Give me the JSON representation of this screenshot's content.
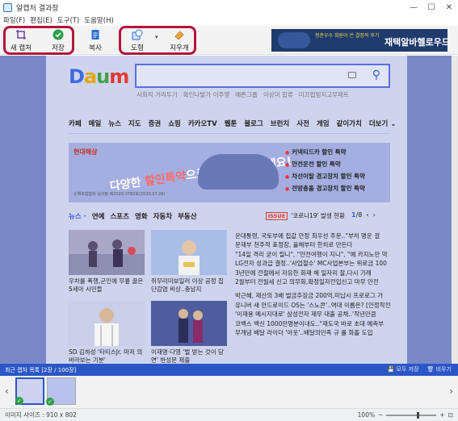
{
  "window": {
    "title": "알캡처 결과창",
    "controls": {
      "minimize": "—",
      "maximize": "☐",
      "close": "✕"
    }
  },
  "menu": [
    "파일(F)",
    "편집(E)",
    "도구(T)",
    "도움말(H)"
  ],
  "toolbar": {
    "new_capture": "새 캡처",
    "save": "저장",
    "copy": "복사",
    "shape": "도형",
    "eraser": "지우개"
  },
  "ad": {
    "small_text": "청춘우수 회원이 쓴 결정적 후기",
    "big_text": "재택알바헬로우드림"
  },
  "daum": {
    "logo": {
      "d": "D",
      "a": "a",
      "u": "u",
      "m": "m"
    },
    "quick_links": [
      "사회적 거리두기",
      "확인나발가 이주영",
      "예른그룹",
      "이상미 합류",
      "미끄럽빙지고무패트"
    ],
    "gnb": [
      "카페",
      "메일",
      "뉴스",
      "지도",
      "증권",
      "쇼핑",
      "카카오TV",
      "웹툰",
      "블로그",
      "브런치",
      "사전",
      "게임",
      "같이가치",
      "더보기 ⌄"
    ],
    "banner": {
      "brand": "현대해상",
      "slogan_prefix": "다양한",
      "slogan_accent": "할인특약",
      "slogan_suffix": "으로 안전 운전하세요!",
      "specials": [
        "커넥티드카 할인 특약",
        "안전운전 할인 특약",
        "차선이탈 경고장치 할인 특약",
        "전방충돌 경고장치 할인 특약"
      ],
      "fine": "손해보험협회 심의필 제2020-3782호(2020.07.06)"
    },
    "news_tabs": [
      "뉴스 ·",
      "연예",
      "스포츠",
      "영화",
      "자동차",
      "부동산"
    ],
    "issue": {
      "tag": "ISSUE",
      "text": "'코로나19' 발생 현황"
    },
    "pager": {
      "current": "1",
      "total": "/8",
      "prev": "‹",
      "next": "›"
    },
    "captions": [
      "우차를 폭행,군인에 무릎 꿇은 5세아 시민들",
      "쥐무리미보일러 이상 공정 집단감염 비상..충남지",
      "SD 김하성 '타티스Jr. 마저 의 바라보는 기분'",
      "이재명·다영 '벌 받는 것이 당연' 반성문 제출"
    ],
    "headlines": [
      "운대통령, 국토부에 집값 안정 최우선 주문..\"부처 명운 걸",
      "문재부 천주적 표정장, 올해부터 한치로 만든다",
      "\"14일 격리 굳이 릴니\", \"안전여행이 지니\", \"예 카지노만 막",
      "LG전자 성과급 결정..'사업철수' MC사업본부는 위로금 100",
      "3년만에 전철에서 자유한 화재 해 일자리 잘,다시 기래",
      "2월부터 전월세 신고 의무화,확정일자전입신고 마무 안전",
      "박근혜, 재산의 3배 벌금추징금 200억,미납시 프로로그 가",
      "유니버 새 안드로이드 OS는 '스노콘'..역대 이름은? [안정작전",
      "'이재용 메시지대로' 삼성전자 재무 대출 공채..'작년만큼",
      "코백스 백신 1000만명분이내도..\"재도국 바로 초대 예측부",
      "무개념 배달 라이더 '아웃'..배달의민족 규 률 화돌 도입"
    ]
  },
  "recent": {
    "title": "최근 캡처 목록 [2장 / 100장]",
    "save_all": "모두 저장",
    "clear": "비우기",
    "prev": "‹",
    "next": "›"
  },
  "status": {
    "image_size": "이미지 사이즈 : 910 x 802",
    "zoom": "100%",
    "zoom_level": 0.6,
    "minus": "−",
    "plus": "+"
  },
  "colors": {
    "accent": "#2b57c6",
    "highlight_box": "#b3163c",
    "canvas_bg": "#7b88c8"
  }
}
